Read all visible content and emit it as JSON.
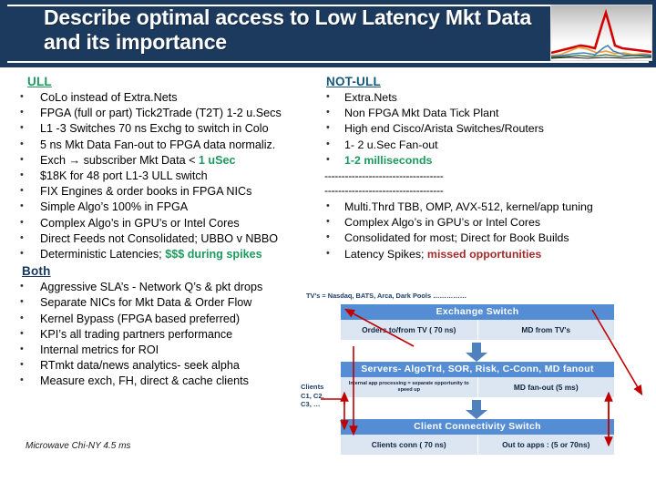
{
  "banner": {
    "title": "Describe optimal access to Low Latency Mkt Data and its importance",
    "thumb_name": "latency-spike-chart-thumbnail",
    "bg_color": "#1c3a5e"
  },
  "left_column": {
    "ull": {
      "heading": "ULL",
      "heading_color": "#1d9a5e",
      "bullets": [
        {
          "text": "CoLo  instead of Extra.Nets"
        },
        {
          "text": "FPGA (full or part) Tick2Trade (T2T) 1-2 u.Secs"
        },
        {
          "text": "L1 -3 Switches 70 ns Exchg to switch in Colo"
        },
        {
          "text": "5 ns Mkt Data Fan-out to FPGA data normaliz."
        },
        {
          "text": "Exch → subscriber Mkt Data < ",
          "highlight": "1 uSec",
          "highlight_color": "#1d9a5e"
        },
        {
          "text": "$18K for 48 port L1-3 ULL switch"
        },
        {
          "text": "FIX Engines & order books in FPGA NICs"
        },
        {
          "text": "Simple Algo’s 100% in FPGA"
        },
        {
          "text": "Complex Algo’s in GPU’s or Intel Cores"
        },
        {
          "text": "Direct Feeds not Consolidated; UBBO v NBBO"
        },
        {
          "text": "Deterministic Latencies; ",
          "highlight": "$$$ during spikes",
          "highlight_color": "#1d9a5e"
        }
      ]
    },
    "both": {
      "heading": "Both",
      "heading_color": "#17375e",
      "bullets": [
        {
          "text": "Aggressive SLA’s - Network Q’s & pkt drops"
        },
        {
          "text": "Separate NICs for Mkt Data & Order Flow"
        },
        {
          "text": "Kernel Bypass (FPGA based preferred)"
        },
        {
          "text": "KPI’s all trading partners performance"
        },
        {
          "text": "Internal metrics for ROI"
        },
        {
          "text": "RTmkt data/news analytics- seek alpha"
        },
        {
          "text": "Measure exch, FH, direct & cache clients"
        }
      ]
    },
    "footnote": "Microwave Chi-NY 4.5 ms"
  },
  "right_column": {
    "not_ull": {
      "heading": "NOT-ULL",
      "heading_color": "#16577a",
      "bullets": [
        {
          "text": "Extra.Nets"
        },
        {
          "text": "Non FPGA Mkt Data Tick Plant"
        },
        {
          "text": "High end Cisco/Arista Switches/Routers"
        },
        {
          "text": "1- 2 u.Sec Fan-out"
        },
        {
          "text": "",
          "highlight": "1-2 milliseconds",
          "highlight_color": "#1d9a5e"
        }
      ]
    },
    "separators": [
      "-----------------------------------",
      "-----------------------------------"
    ],
    "bullets2": [
      {
        "text": "Multi.Thrd TBB, OMP, AVX-512, kernel/app tuning"
      },
      {
        "text": "Complex Algo’s in GPU’s or Intel Cores"
      },
      {
        "text": "Consolidated for most; Direct for Book Builds"
      },
      {
        "text": "Latency Spikes; ",
        "highlight": "missed opportunities",
        "highlight_color": "#a52a2a"
      }
    ]
  },
  "diagram": {
    "tv_note": "TV's = Nasdaq, BATS, Arca, Dark Pools ……………",
    "clients_label": "Clients\nC1, C2.\nC3, …",
    "blocks": [
      {
        "title": "Exchange Switch",
        "left_cell": "Orders to/from TV ( 70 ns)",
        "right_cell": "MD from TV's"
      },
      {
        "title": "Servers- AlgoTrd, SOR, Risk, C-Conn, MD fanout",
        "left_cell": "Internal app processing = separate opportunity to speed up",
        "right_cell": "MD fan-out (5 ms)"
      },
      {
        "title": "Client Connectivity Switch",
        "left_cell": "Clients conn ( 70 ns)",
        "right_cell": "Out to apps :  (5 or 70ns)"
      }
    ],
    "bar_color": "#548dd4",
    "sub_color": "#dce6f2",
    "arrow_color": "#c00000"
  }
}
